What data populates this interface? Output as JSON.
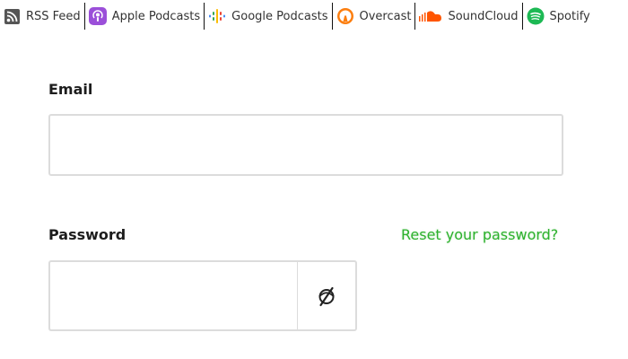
{
  "podcast_links": [
    {
      "label": "RSS Feed",
      "icon": "rss-icon",
      "color": "#555555"
    },
    {
      "label": "Apple Podcasts",
      "icon": "apple-podcasts-icon",
      "color": "#8e44d6"
    },
    {
      "label": "Google Podcasts",
      "icon": "google-podcasts-icon",
      "color": "#4285f4"
    },
    {
      "label": "Overcast",
      "icon": "overcast-icon",
      "color": "#fc7e0f"
    },
    {
      "label": "SoundCloud",
      "icon": "soundcloud-icon",
      "color": "#ff5500"
    },
    {
      "label": "Spotify",
      "icon": "spotify-icon",
      "color": "#1db954"
    }
  ],
  "form": {
    "email_label": "Email",
    "email_value": "",
    "password_label": "Password",
    "password_value": "",
    "reset_link": "Reset your password?",
    "toggle_icon": "eye-off-icon"
  },
  "colors": {
    "accent": "#2db12d",
    "input_border": "#dcdcdc"
  }
}
